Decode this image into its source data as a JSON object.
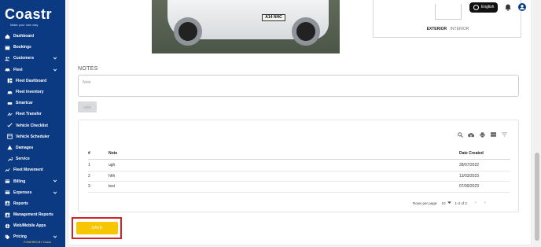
{
  "brand": {
    "name": "Coastr",
    "tagline": "Make your own way",
    "powered_by": "POWERED BY Coastr"
  },
  "header": {
    "language": "English"
  },
  "sidebar": {
    "items": [
      {
        "label": "Dashboard",
        "icon": "home-icon",
        "sub": false,
        "chevron": false
      },
      {
        "label": "Bookings",
        "icon": "calendar-icon",
        "sub": false,
        "chevron": false
      },
      {
        "label": "Customers",
        "icon": "people-icon",
        "sub": false,
        "chevron": true
      },
      {
        "label": "Fleet",
        "icon": "car-icon",
        "sub": false,
        "chevron": true
      },
      {
        "label": "Fleet Dashboard",
        "icon": "dashboard-icon",
        "sub": true,
        "chevron": false
      },
      {
        "label": "Fleet Inventory",
        "icon": "car-icon",
        "sub": true,
        "chevron": false
      },
      {
        "label": "Smartcar",
        "icon": "smartcar-icon",
        "sub": true,
        "chevron": false
      },
      {
        "label": "Fleet Transfer",
        "icon": "transfer-icon",
        "sub": true,
        "chevron": false
      },
      {
        "label": "Vehicle Checklist",
        "icon": "checklist-icon",
        "sub": true,
        "chevron": false
      },
      {
        "label": "Vehicle Scheduler",
        "icon": "scheduler-icon",
        "sub": true,
        "chevron": false
      },
      {
        "label": "Damages",
        "icon": "warning-icon",
        "sub": true,
        "chevron": false
      },
      {
        "label": "Service",
        "icon": "wrench-icon",
        "sub": true,
        "chevron": false
      },
      {
        "label": "Fleet Movement",
        "icon": "movement-icon",
        "sub": false,
        "chevron": false
      },
      {
        "label": "Billing",
        "icon": "billing-icon",
        "sub": false,
        "chevron": true
      },
      {
        "label": "Expenses",
        "icon": "expenses-icon",
        "sub": false,
        "chevron": true
      },
      {
        "label": "Reports",
        "icon": "reports-icon",
        "sub": false,
        "chevron": false
      },
      {
        "label": "Management Reports",
        "icon": "reports-icon",
        "sub": false,
        "chevron": false
      },
      {
        "label": "Web/Mobile Apps",
        "icon": "globe-icon",
        "sub": false,
        "chevron": false
      },
      {
        "label": "Pricing",
        "icon": "tag-icon",
        "sub": false,
        "chevron": true
      }
    ]
  },
  "vehicle": {
    "plate": "A14 NHC",
    "tabs": {
      "exterior": "EXTERIOR",
      "interior": "INTERIOR"
    }
  },
  "notes": {
    "title": "NOTES",
    "placeholder": "Note",
    "add_label": "ADD",
    "table": {
      "headers": [
        "#",
        "Note",
        "Date Created"
      ],
      "rows": [
        [
          "1",
          "ugh",
          "28/07/2022"
        ],
        [
          "2",
          "hhh",
          "13/03/2023"
        ],
        [
          "3",
          "test",
          "07/09/2023"
        ]
      ]
    },
    "pager": {
      "rows_per_page_label": "Rows per page:",
      "rows_per_page": "10",
      "range": "1-3 of 3"
    }
  },
  "actions": {
    "save_label": "SAVE"
  },
  "colors": {
    "sidebar": "#0b3a82",
    "save": "#f6c600",
    "highlight": "#d22424"
  }
}
